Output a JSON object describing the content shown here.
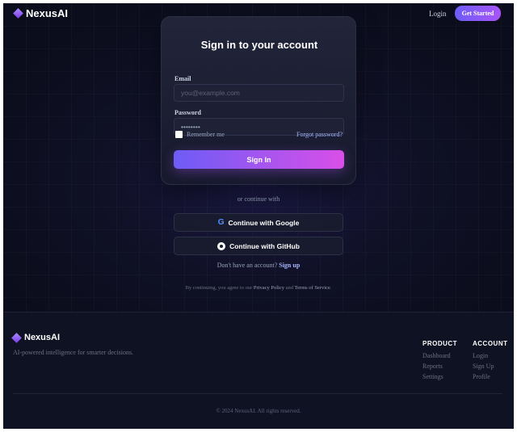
{
  "header": {
    "brand": "NexusAI",
    "login_label": "Login",
    "cta_label": "Get Started"
  },
  "signin": {
    "title": "Sign in to your account",
    "email_label": "Email",
    "email_placeholder": "you@example.com",
    "password_label": "Password",
    "password_value": "••••••••",
    "remember_label": "Remember me",
    "remember_checked": false,
    "forgot_label": "Forgot password?",
    "submit_label": "Sign In"
  },
  "divider_text": "or continue with",
  "social": {
    "google_label": "Continue with Google",
    "github_label": "Continue with GitHub"
  },
  "signup": {
    "prompt": "Don't have an account?",
    "link_label": "Sign up"
  },
  "terms": {
    "prefix": "By continuing, you agree to our",
    "privacy": "Privacy Policy",
    "and": "and",
    "tos": "Terms of Service",
    "suffix": "."
  },
  "footer": {
    "brand": "NexusAI",
    "tagline": "AI-powered intelligence for smarter decisions.",
    "columns": [
      {
        "title": "PRODUCT",
        "links": [
          "Dashboard",
          "Reports",
          "Settings"
        ]
      },
      {
        "title": "ACCOUNT",
        "links": [
          "Login",
          "Sign Up",
          "Profile"
        ]
      }
    ],
    "copyright": "© 2024 NexusAI. All rights reserved."
  },
  "colors": {
    "accent_start": "#6d5cf6",
    "accent_end": "#d94fe8",
    "link": "#a5b4fc",
    "background": "#0f1024"
  }
}
